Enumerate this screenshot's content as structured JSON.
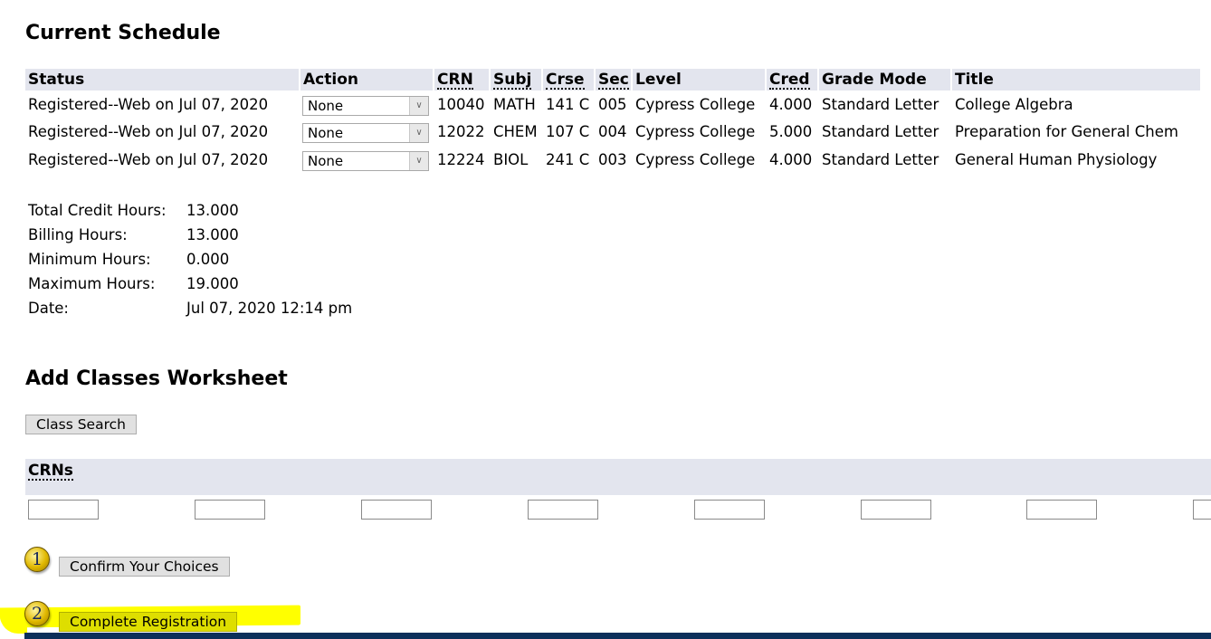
{
  "schedule": {
    "heading": "Current Schedule",
    "columns": [
      "Status",
      "Action",
      "CRN",
      "Subj",
      "Crse",
      "Sec",
      "Level",
      "Cred",
      "Grade Mode",
      "Title"
    ],
    "rows": [
      {
        "status": "Registered--Web on Jul 07, 2020",
        "action": "None",
        "crn": "10040",
        "subj": "MATH",
        "crse": "141 C",
        "sec": "005",
        "level": "Cypress College",
        "cred": "4.000",
        "grade_mode": "Standard Letter",
        "title": "College Algebra"
      },
      {
        "status": "Registered--Web on Jul 07, 2020",
        "action": "None",
        "crn": "12022",
        "subj": "CHEM",
        "crse": "107 C",
        "sec": "004",
        "level": "Cypress College",
        "cred": "5.000",
        "grade_mode": "Standard Letter",
        "title": "Preparation for General Chem"
      },
      {
        "status": "Registered--Web on Jul 07, 2020",
        "action": "None",
        "crn": "12224",
        "subj": "BIOL",
        "crse": "241 C",
        "sec": "003",
        "level": "Cypress College",
        "cred": "4.000",
        "grade_mode": "Standard Letter",
        "title": "General Human Physiology"
      }
    ]
  },
  "summary": [
    {
      "label": "Total Credit Hours:",
      "value": "13.000"
    },
    {
      "label": "Billing Hours:",
      "value": "13.000"
    },
    {
      "label": "Minimum Hours:",
      "value": "0.000"
    },
    {
      "label": "Maximum Hours:",
      "value": "19.000"
    },
    {
      "label": "Date:",
      "value": "Jul 07, 2020 12:14 pm"
    }
  ],
  "worksheet": {
    "heading": "Add Classes Worksheet",
    "class_search_label": "Class Search",
    "crns_header": "CRNs",
    "crn_values": [
      "",
      "",
      "",
      "",
      "",
      "",
      "",
      ""
    ],
    "step1_number": "1",
    "confirm_label": "Confirm Your Choices",
    "step2_number": "2",
    "complete_label": "Complete Registration"
  },
  "colors": {
    "header_bg": "#e3e5ee",
    "highlight": "#ffff00",
    "footer_bar": "#0c2f5a"
  }
}
